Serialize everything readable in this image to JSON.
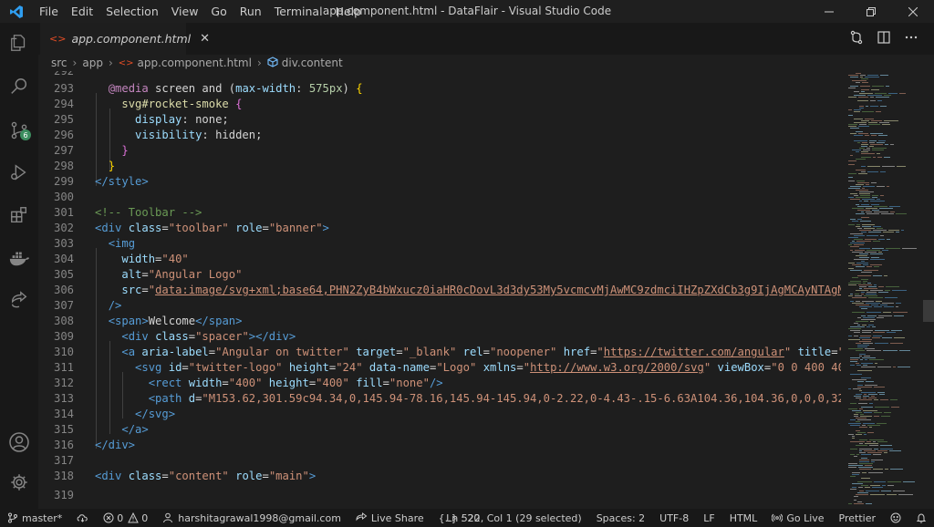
{
  "titlebar": {
    "menu": [
      "File",
      "Edit",
      "Selection",
      "View",
      "Go",
      "Run",
      "Terminal",
      "Help"
    ],
    "title": "app.component.html - DataFlair - Visual Studio Code"
  },
  "activity_badge": "6",
  "tab": {
    "label": "app.component.html",
    "close": "✕"
  },
  "breadcrumb": {
    "items": [
      "src",
      "app",
      "app.component.html",
      "div.content"
    ]
  },
  "editor": {
    "first_partial_line": "292",
    "lines": [
      {
        "n": "293"
      },
      {
        "n": "294"
      },
      {
        "n": "295"
      },
      {
        "n": "296"
      },
      {
        "n": "297"
      },
      {
        "n": "298"
      },
      {
        "n": "299"
      },
      {
        "n": "300"
      },
      {
        "n": "301"
      },
      {
        "n": "302"
      },
      {
        "n": "303"
      },
      {
        "n": "304"
      },
      {
        "n": "305"
      },
      {
        "n": "306"
      },
      {
        "n": "307"
      },
      {
        "n": "308"
      },
      {
        "n": "309"
      },
      {
        "n": "310"
      },
      {
        "n": "311"
      },
      {
        "n": "312"
      },
      {
        "n": "313"
      },
      {
        "n": "314"
      },
      {
        "n": "315"
      },
      {
        "n": "316"
      },
      {
        "n": "317"
      },
      {
        "n": "318"
      },
      {
        "n": "319"
      }
    ]
  },
  "statusbar": {
    "branch": "master*",
    "errors": "0",
    "warnings": "0",
    "account": "harshitagrawal1998@gmail.com",
    "live_share": "Live Share",
    "selection_count": "{..} : 20",
    "position": "Ln 522, Col 1 (29 selected)",
    "spaces": "Spaces: 2",
    "encoding": "UTF-8",
    "eol": "LF",
    "language": "HTML",
    "go_live": "Go Live",
    "prettier": "Prettier"
  },
  "colors": {
    "accent_blue": "#569cd6",
    "string": "#ce9178",
    "attribute": "#9cdcfe",
    "comment": "#6a9955",
    "html_icon": "#e44d26"
  }
}
